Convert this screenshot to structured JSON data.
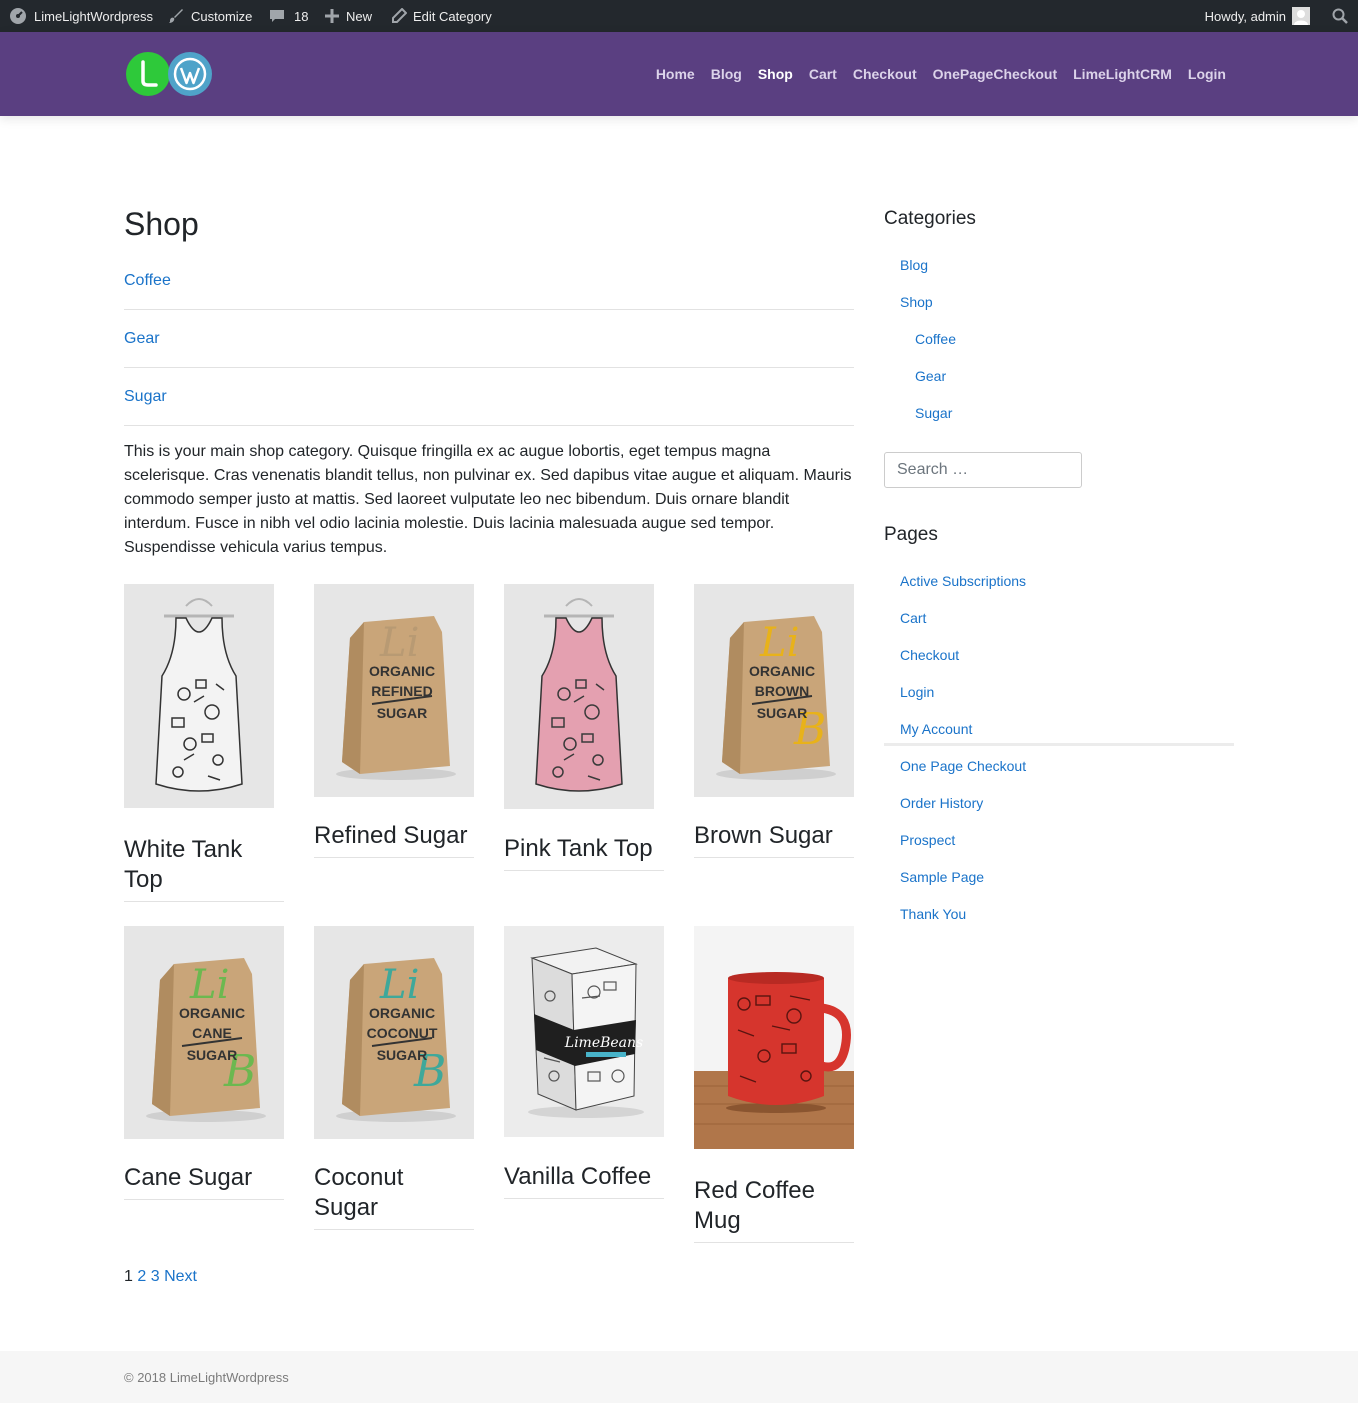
{
  "adminbar": {
    "site_name": "LimeLightWordpress",
    "customize": "Customize",
    "comments_count": "18",
    "new_label": "New",
    "edit_label": "Edit Category",
    "howdy": "Howdy, admin"
  },
  "nav": {
    "items": [
      "Home",
      "Blog",
      "Shop",
      "Cart",
      "Checkout",
      "OnePageCheckout",
      "LimeLightCRM",
      "Login"
    ],
    "active": "Shop"
  },
  "main": {
    "title": "Shop",
    "subcategories": [
      "Coffee",
      "Gear",
      "Sugar"
    ],
    "description": "This is your main shop category. Quisque fringilla ex ac augue lobortis, eget tempus magna scelerisque. Cras venenatis blandit tellus, non pulvinar ex. Sed dapibus vitae augue et aliquam. Mauris commodo semper justo at mattis. Sed laoreet vulputate leo nec bibendum. Duis ornare blandit interdum. Fusce in nibh vel odio lacinia molestie. Duis lacinia malesuada augue sed tempor. Suspendisse vehicula varius tempus.",
    "products": [
      {
        "name": "White Tank Top",
        "image": "white-tank-top-image"
      },
      {
        "name": "Refined Sugar",
        "image": "refined-sugar-bag-image",
        "bag_text": [
          "ORGANIC",
          "REFINED",
          "SUGAR"
        ]
      },
      {
        "name": "Pink Tank Top",
        "image": "pink-tank-top-image"
      },
      {
        "name": "Brown Sugar",
        "image": "brown-sugar-bag-image",
        "bag_text": [
          "ORGANIC",
          "BROWN",
          "SUGAR"
        ]
      },
      {
        "name": "Cane Sugar",
        "image": "cane-sugar-bag-image",
        "bag_text": [
          "ORGANIC",
          "CANE",
          "SUGAR"
        ]
      },
      {
        "name": "Coconut Sugar",
        "image": "coconut-sugar-bag-image",
        "bag_text": [
          "ORGANIC",
          "COCONUT",
          "SUGAR"
        ]
      },
      {
        "name": "Vanilla Coffee",
        "image": "vanilla-coffee-box-image",
        "box_brand": "LimeBeans"
      },
      {
        "name": "Red Coffee Mug",
        "image": "red-coffee-mug-image"
      }
    ],
    "pagination": {
      "current": "1",
      "pages": [
        "2",
        "3"
      ],
      "next": "Next"
    }
  },
  "sidebar": {
    "categories_title": "Categories",
    "categories": [
      "Blog",
      "Shop"
    ],
    "subcategories": [
      "Coffee",
      "Gear",
      "Sugar"
    ],
    "search_placeholder": "Search …",
    "pages_title": "Pages",
    "pages": [
      "Active Subscriptions",
      "Cart",
      "Checkout",
      "Login",
      "My Account",
      "One Page Checkout",
      "Order History",
      "Prospect",
      "Sample Page",
      "Thank You"
    ]
  },
  "footer": {
    "copyright": "© 2018 LimeLightWordpress"
  },
  "colors": {
    "header_bg": "#5a3f81",
    "adminbar_bg": "#23282d",
    "link": "#1a73c9",
    "logo_green": "#2ec93a",
    "logo_blue": "#4fa3c9"
  }
}
